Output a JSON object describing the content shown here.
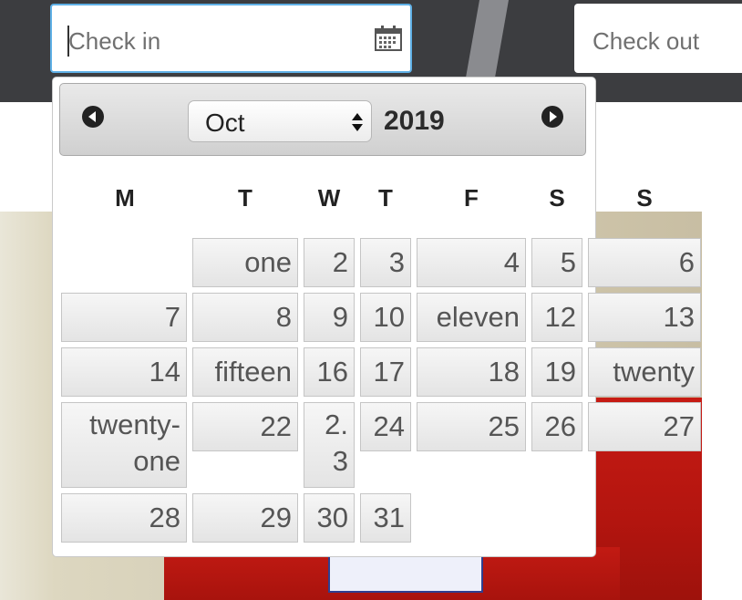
{
  "top_bar": {
    "check_in": {
      "placeholder": "Check in",
      "icon": "calendar-icon"
    },
    "check_out": {
      "placeholder": "Check out"
    }
  },
  "datepicker": {
    "prev_icon": "chevron-left-icon",
    "next_icon": "chevron-right-icon",
    "month": "Oct",
    "year": "2019",
    "weekdays": [
      "M",
      "T",
      "W",
      "T",
      "F",
      "S",
      "S"
    ],
    "days": [
      "one",
      "2",
      "3",
      "4",
      "5",
      "6",
      "7",
      "8",
      "9",
      "10",
      "eleven",
      "12",
      "13",
      "14",
      "fifteen",
      "16",
      "17",
      "18",
      "19",
      "twenty",
      "twenty-one",
      "22",
      "2. 3",
      "24",
      "25",
      "26",
      "27",
      "28",
      "29",
      "30",
      "31"
    ]
  }
}
